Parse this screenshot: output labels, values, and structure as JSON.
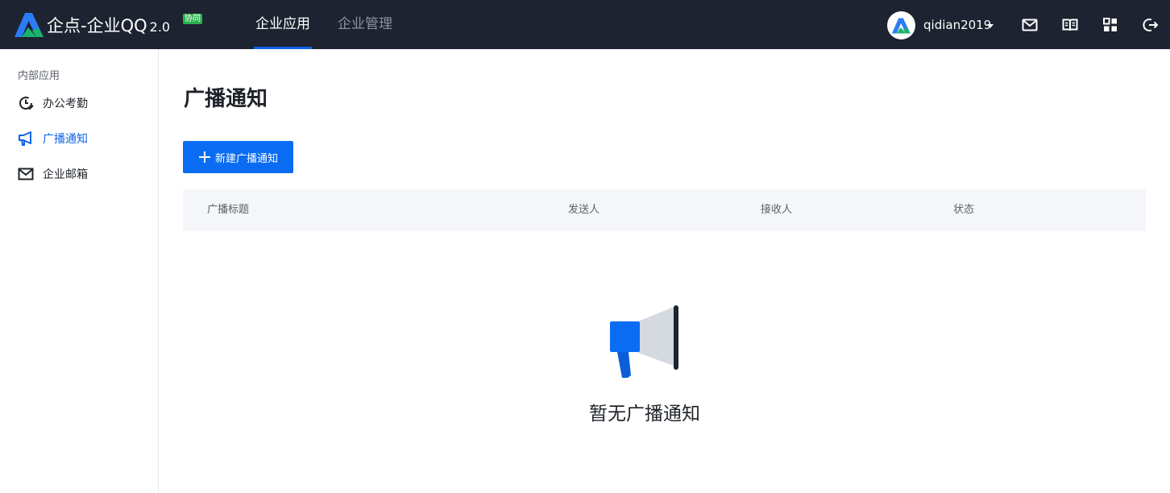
{
  "header": {
    "logo_text": "企点-企业QQ",
    "logo_version": "2.0",
    "logo_badge": "协同",
    "tabs": [
      {
        "label": "企业应用",
        "active": true
      },
      {
        "label": "企业管理",
        "active": false
      }
    ],
    "username": "qidian2019",
    "icons": [
      "mail-icon",
      "book-icon",
      "apps-grid-icon",
      "logout-icon"
    ]
  },
  "sidebar": {
    "group_label": "内部应用",
    "items": [
      {
        "label": "办公考勤",
        "icon": "attendance-clock-icon",
        "active": false
      },
      {
        "label": "广播通知",
        "icon": "megaphone-icon",
        "active": true
      },
      {
        "label": "企业邮箱",
        "icon": "mail-icon",
        "active": false
      }
    ]
  },
  "main": {
    "title": "广播通知",
    "new_button_label": "新建广播通知",
    "table_columns": [
      "广播标题",
      "发送人",
      "接收人",
      "状态"
    ],
    "empty_text": "暂无广播通知"
  },
  "colors": {
    "topbar": "#1d2330",
    "accent": "#0e63ea",
    "button": "#0a6cf2",
    "badge": "#2bb24c",
    "table_header_bg": "#f5f6f9"
  }
}
